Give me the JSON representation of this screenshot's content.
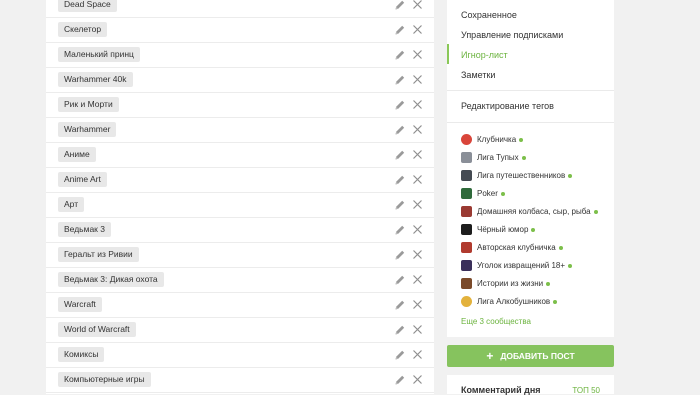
{
  "tags": [
    {
      "label": "Dead Space"
    },
    {
      "label": "Скелетор"
    },
    {
      "label": "Маленький принц"
    },
    {
      "label": "Warhammer 40k"
    },
    {
      "label": "Рик и Морти"
    },
    {
      "label": "Warhammer"
    },
    {
      "label": "Аниме"
    },
    {
      "label": "Anime Art"
    },
    {
      "label": "Арт"
    },
    {
      "label": "Ведьмак 3"
    },
    {
      "label": "Геральт из Ривии"
    },
    {
      "label": "Ведьмак 3: Дикая охота"
    },
    {
      "label": "Warcraft"
    },
    {
      "label": "World of Warcraft"
    },
    {
      "label": "Комиксы"
    },
    {
      "label": "Компьютерные игры"
    }
  ],
  "menu": {
    "saved": "Сохраненное",
    "subscriptions": "Управление подписками",
    "ignore_list": "Игнор-лист",
    "notes": "Заметки",
    "edit_tags": "Редактирование тегов"
  },
  "communities": [
    {
      "name": "Клубничка",
      "icon": "strawberry-avatar-icon"
    },
    {
      "name": "Лига Тупых",
      "icon": "league-dumb-avatar-icon"
    },
    {
      "name": "Лига путешественников",
      "icon": "travelers-avatar-icon"
    },
    {
      "name": "Poker",
      "icon": "poker-avatar-icon"
    },
    {
      "name": "Домашняя колбаса, сыр, рыба",
      "icon": "sausage-avatar-icon"
    },
    {
      "name": "Чёрный юмор",
      "icon": "black-humor-avatar-icon"
    },
    {
      "name": "Авторская клубничка",
      "icon": "author-strawberry-avatar-icon"
    },
    {
      "name": "Уголок извращений 18+",
      "icon": "corner-18-avatar-icon"
    },
    {
      "name": "Истории из жизни",
      "icon": "life-stories-avatar-icon"
    },
    {
      "name": "Лига Алкобушников",
      "icon": "alcohol-league-avatar-icon"
    }
  ],
  "more_communities": "Еще 3 сообщества",
  "add_post": {
    "label": "ДОБАВИТЬ ПОСТ",
    "icon": "plus-icon"
  },
  "comment_of_day": {
    "title": "Комментарий дня",
    "top_link": "ТОП 50"
  },
  "colors": {
    "accent": "#6bb33e",
    "button": "#86c35e",
    "online_dot": "#7cbf4a",
    "chip": "#e8e8e8"
  }
}
